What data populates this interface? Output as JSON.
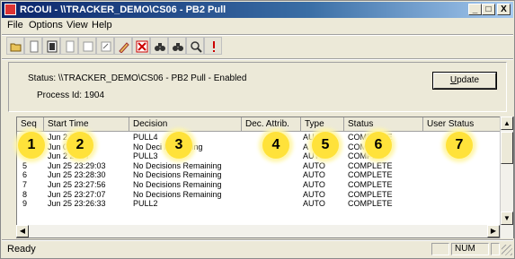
{
  "window": {
    "title": "RCOUI - \\\\TRACKER_DEMO\\CS06 - PB2 Pull",
    "controls": {
      "minimize": "_",
      "maximize": "□",
      "close": "X"
    }
  },
  "menu": [
    "File",
    "Options",
    "View",
    "Help"
  ],
  "toolbar": {
    "buttons": [
      "open-folder-icon",
      "page-icon",
      "print-preview-icon",
      "page-icon",
      "page-icon",
      "write-icon",
      "edit-pen-icon",
      "delete-x-icon",
      "binoculars-icon",
      "binoculars-icon",
      "magnifier-icon",
      "exclamation-icon"
    ]
  },
  "info": {
    "status": "Status: \\\\TRACKER_DEMO\\CS06 - PB2 Pull - Enabled",
    "process": "Process Id: 1904",
    "update_prefix": "",
    "update_underlined": "U",
    "update_rest": "pdate"
  },
  "table": {
    "columns": [
      "Seq",
      "Start Time",
      "Decision",
      "Dec. Attrib.",
      "Type",
      "Status",
      "User Status"
    ],
    "rows": [
      {
        "seq": "",
        "time": "Jun 2  30:44",
        "decision": "PULL4",
        "attrib": "",
        "type": "AU",
        "status": "COMPLETE",
        "user": ""
      },
      {
        "seq": "",
        "time": "Jun   0:10",
        "decision": "No Deci  Remaining",
        "attrib": "",
        "type": "A",
        "status": "COM  ETE",
        "user": ""
      },
      {
        "seq": "",
        "time": "Jun 2  29:37",
        "decision": "PULL3",
        "attrib": "",
        "type": "AUTO",
        "status": "COMPL  E",
        "user": ""
      },
      {
        "seq": "5",
        "time": "Jun 25 23:29:03",
        "decision": "No Decisions Remaining",
        "attrib": "",
        "type": "AUTO",
        "status": "COMPLETE",
        "user": ""
      },
      {
        "seq": "6",
        "time": "Jun 25 23:28:30",
        "decision": "No Decisions Remaining",
        "attrib": "",
        "type": "AUTO",
        "status": "COMPLETE",
        "user": ""
      },
      {
        "seq": "7",
        "time": "Jun 25 23:27:56",
        "decision": "No Decisions Remaining",
        "attrib": "",
        "type": "AUTO",
        "status": "COMPLETE",
        "user": ""
      },
      {
        "seq": "8",
        "time": "Jun 25 23:27:07",
        "decision": "No Decisions Remaining",
        "attrib": "",
        "type": "AUTO",
        "status": "COMPLETE",
        "user": ""
      },
      {
        "seq": "9",
        "time": "Jun 25 23:26:33",
        "decision": "PULL2",
        "attrib": "",
        "type": "AUTO",
        "status": "COMPLETE",
        "user": ""
      }
    ]
  },
  "callouts": [
    "1",
    "2",
    "3",
    "4",
    "5",
    "6",
    "7"
  ],
  "statusbar": {
    "text": "Ready",
    "num": "NUM"
  }
}
